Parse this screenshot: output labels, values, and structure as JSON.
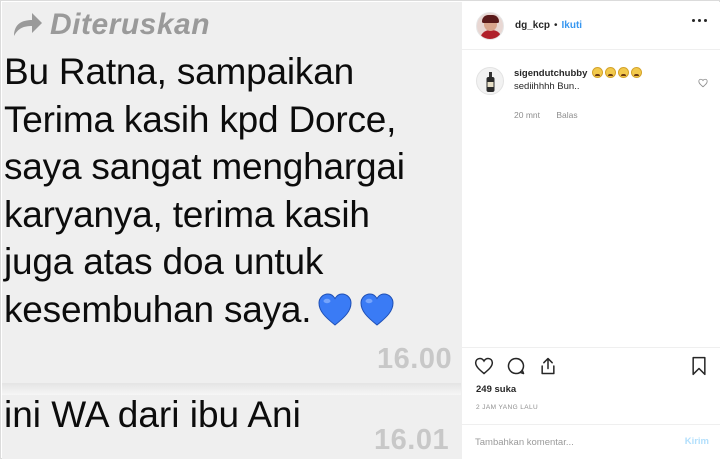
{
  "photo": {
    "forwarded_label": "Diteruskan",
    "message_lines": [
      "Bu Ratna, sampaikan",
      "Terima kasih kpd Dorce,",
      "saya sangat menghargai",
      "karyanya, terima kasih",
      "juga atas doa untuk",
      "kesembuhan saya."
    ],
    "time_1": "16.00",
    "message_2": "ini WA dari ibu Ani",
    "time_2": "16.01",
    "heart_color": "#3a7bf5"
  },
  "post": {
    "username": "dg_kcp",
    "follow_label": "Ikuti",
    "comment": {
      "username": "sigendutchubby",
      "text": "sediihhhh Bun..",
      "time": "20 mnt",
      "reply_label": "Balas",
      "emoji_count": 4
    },
    "likes": "249 suka",
    "posted_ago": "2 JAM YANG LALU",
    "comment_placeholder": "Tambahkan komentar...",
    "send_label": "Kirim"
  },
  "colors": {
    "accent": "#3897f0",
    "send_disabled": "#b2dffc",
    "muted": "#8e8e8e"
  },
  "icons": [
    "forward-arrow-icon",
    "heart-emoji-icon",
    "more-options-icon",
    "like-icon",
    "comment-icon",
    "share-icon",
    "bookmark-icon"
  ]
}
